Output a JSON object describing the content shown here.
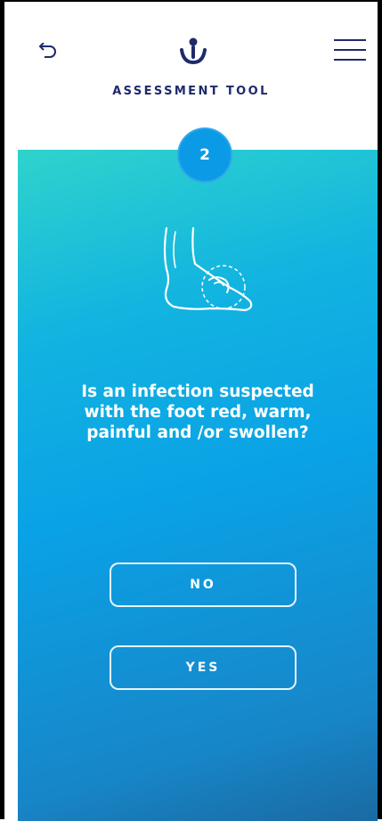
{
  "header": {
    "title": "ASSESSMENT TOOL",
    "back_icon": "undo-arrow-icon",
    "logo_icon": "person-logo-icon",
    "menu_icon": "hamburger-menu-icon"
  },
  "step": {
    "number": "2"
  },
  "illustration": {
    "icon": "foot-infection-icon"
  },
  "question": {
    "text": "Is an infection suspected with the foot red, warm, painful and /or swollen?"
  },
  "answers": {
    "no_label": "NO",
    "yes_label": "YES"
  },
  "colors": {
    "title": "#1f2a6b",
    "gradient_start": "#2fd3cc",
    "gradient_mid": "#0aa2e6",
    "gradient_end": "#1a6aa2",
    "badge": "#0b9ae6"
  }
}
